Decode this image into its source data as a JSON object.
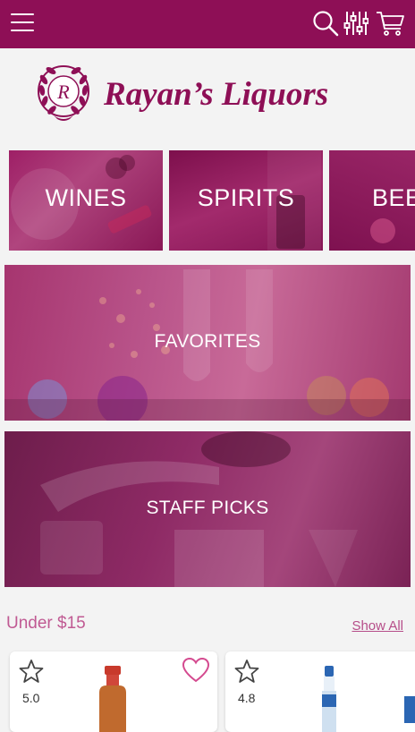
{
  "header": {
    "menu_icon": "hamburger-menu-icon",
    "search_icon": "search-icon",
    "filter_icon": "filter-sliders-icon",
    "cart_icon": "shopping-cart-icon",
    "bar_color": "#8e0f56"
  },
  "brand": {
    "name": "Rayan’s Liquors",
    "seal_letter": "R",
    "color": "#8e0f56"
  },
  "categories": [
    {
      "label": "WINES"
    },
    {
      "label": "SPIRITS"
    },
    {
      "label": "BEER"
    }
  ],
  "banners": [
    {
      "label": "FAVORITES"
    },
    {
      "label": "STAFF PICKS"
    }
  ],
  "section": {
    "title": "Under $15",
    "show_all": "Show All"
  },
  "products": [
    {
      "rating": "5.0",
      "favorite_icon": "heart-icon",
      "star_icon": "star-outline-icon"
    },
    {
      "rating": "4.8",
      "favorite_icon": "heart-icon",
      "star_icon": "star-outline-icon"
    }
  ]
}
